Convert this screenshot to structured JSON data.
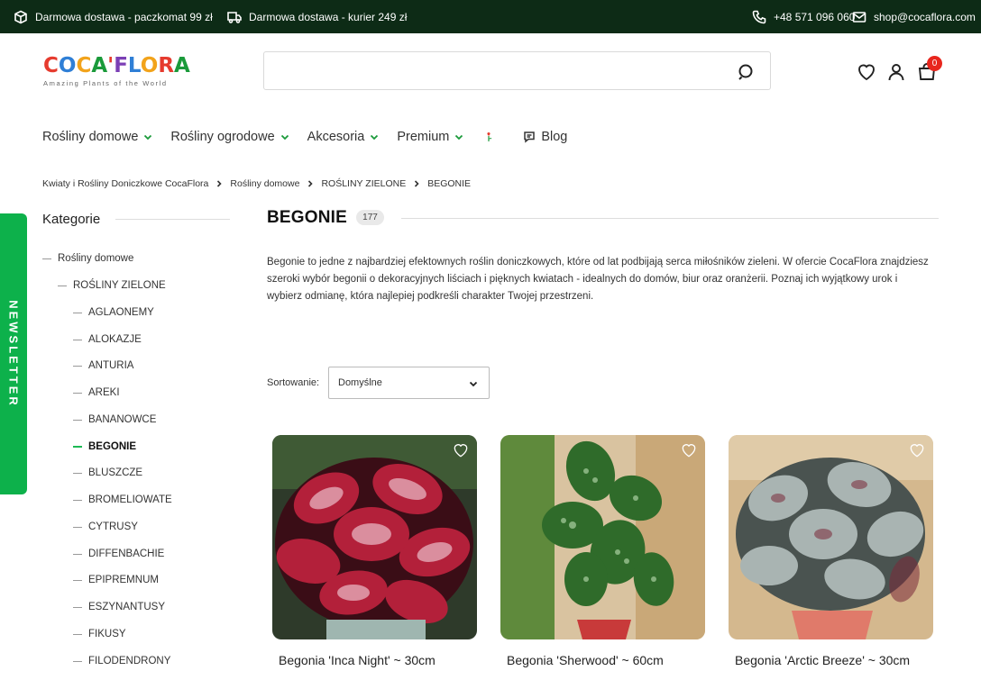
{
  "topbar": {
    "shipping_parcel": "Darmowa dostawa - paczkomat 99 zł",
    "shipping_courier": "Darmowa dostawa - kurier 249 zł",
    "phone": "+48 571 096 060",
    "email": "shop@cocaflora.com"
  },
  "header": {
    "logo_subtitle": "Amazing Plants of the World",
    "search_placeholder": "",
    "cart_count": "0"
  },
  "nav": {
    "items": [
      "Rośliny domowe",
      "Rośliny ogrodowe",
      "Akcesoria",
      "Premium"
    ],
    "blog": "Blog"
  },
  "breadcrumb": [
    "Kwiaty i Rośliny Doniczkowe CocaFlora",
    "Rośliny domowe",
    "ROŚLINY ZIELONE",
    "BEGONIE"
  ],
  "newsletter": "NEWSLETTER",
  "sidebar": {
    "title": "Kategorie",
    "root": "Rośliny domowe",
    "group": "ROŚLINY ZIELONE",
    "items": [
      "AGLAONEMY",
      "ALOKAZJE",
      "ANTURIA",
      "AREKI",
      "BANANOWCE",
      "BEGONIE",
      "BLUSZCZE",
      "BROMELIOWATE",
      "CYTRUSY",
      "DIFFENBACHIE",
      "EPIPREMNUM",
      "ESZYNANTUSY",
      "FIKUSY",
      "FILODENDRONY"
    ],
    "active": "BEGONIE"
  },
  "main": {
    "title": "BEGONIE",
    "count": "177",
    "description": "Begonie to jedne z najbardziej efektownych roślin doniczkowych, które od lat podbijają serca miłośników zieleni. W ofercie CocaFlora znajdziesz szeroki wybór begonii o dekoracyjnych liściach i pięknych kwiatach - idealnych do domów, biur oraz oranżerii. Poznaj ich wyjątkowy urok i wybierz odmianę, która najlepiej podkreśli charakter Twojej przestrzeni.",
    "sort_label": "Sortowanie:",
    "sort_value": "Domyślne"
  },
  "products": [
    {
      "name": "Begonia 'Inca Night' ~ 30cm"
    },
    {
      "name": "Begonia 'Sherwood' ~ 60cm"
    },
    {
      "name": "Begonia 'Arctic Breeze' ~ 30cm"
    }
  ],
  "colors": {
    "topbar_bg": "#0d2b16",
    "accent_green": "#1a9a3a",
    "newsletter_green": "#0db14b",
    "badge_red": "#e8261d"
  }
}
